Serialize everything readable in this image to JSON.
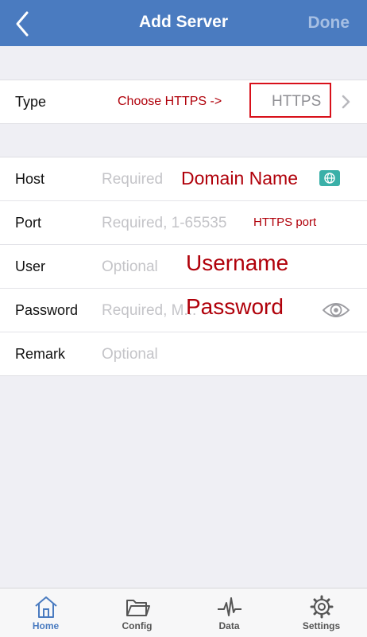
{
  "navbar": {
    "title": "Add Server",
    "done_label": "Done"
  },
  "type_row": {
    "label": "Type",
    "value": "HTTPS",
    "annotation": "Choose HTTPS ->"
  },
  "fields": {
    "host": {
      "label": "Host",
      "placeholder": "Required",
      "annotation": "Domain Name"
    },
    "port": {
      "label": "Port",
      "placeholder": "Required, 1-65535",
      "annotation": "HTTPS port"
    },
    "user": {
      "label": "User",
      "placeholder": "Optional",
      "annotation": "Username"
    },
    "password": {
      "label": "Password",
      "placeholder": "Required, M...",
      "annotation": "Password"
    },
    "remark": {
      "label": "Remark",
      "placeholder": "Optional"
    }
  },
  "tabs": {
    "home": "Home",
    "config": "Config",
    "data": "Data",
    "settings": "Settings"
  },
  "colors": {
    "accent": "#4a7bc0",
    "annotation": "#b0000a",
    "annotation_box": "#d8101a"
  }
}
